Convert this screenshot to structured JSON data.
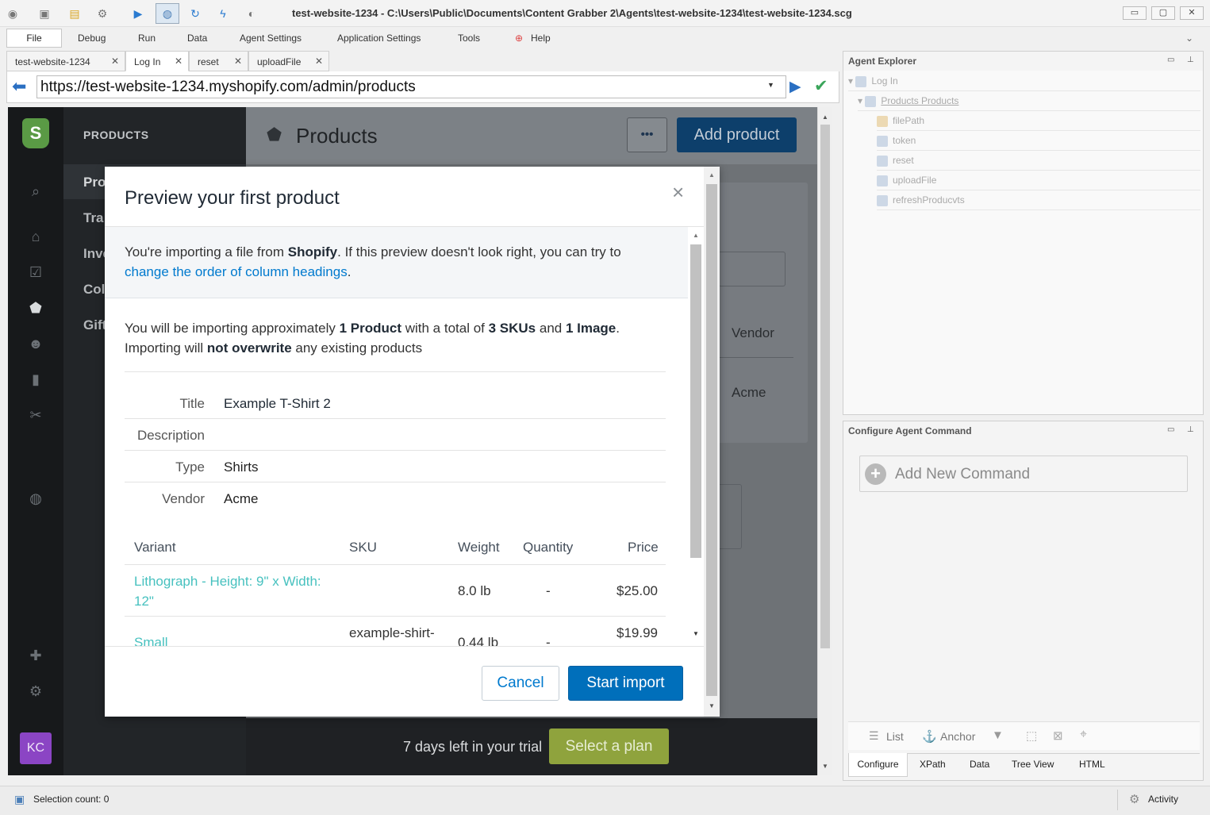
{
  "window": {
    "title": "test-website-1234 - C:\\Users\\Public\\Documents\\Content Grabber 2\\Agents\\test-website-1234\\test-website-1234.scg",
    "controls": [
      "▭",
      "▢",
      "✕"
    ]
  },
  "menu": {
    "items": [
      "File",
      "Debug",
      "Run",
      "Data",
      "Agent Settings",
      "Application Settings",
      "Tools",
      "Help"
    ]
  },
  "tabs": [
    {
      "label": "test-website-1234"
    },
    {
      "label": "Log In"
    },
    {
      "label": "reset"
    },
    {
      "label": "uploadFile"
    }
  ],
  "urlbar": {
    "url": "https://test-website-1234.myshopify.com/admin/products"
  },
  "shopify": {
    "section_title": "PRODUCTS",
    "nav": [
      "Pro",
      "Tra",
      "Inve",
      "Col",
      "Gift"
    ],
    "page_title": "Products",
    "more_label": "•••",
    "add_product_label": "Add product",
    "bg_vendor_header": "Vendor",
    "bg_vendor_value": "Acme",
    "avatar": "KC",
    "trial_text": "7 days left in your trial",
    "select_plan_label": "Select a plan"
  },
  "modal": {
    "title": "Preview your first product",
    "close": "×",
    "info_pre": "You're importing a file from ",
    "info_source": "Shopify",
    "info_post": ". If this preview doesn't look right, you can try to",
    "info_link": "change the order of column headings",
    "info_period": ".",
    "summary1_pre": "You will be importing approximately ",
    "summary1_products": "1 Product",
    "summary1_mid": " with a total of ",
    "summary1_skus": "3 SKUs",
    "summary1_and": " and ",
    "summary1_images": "1 Image",
    "summary1_end": ".",
    "summary2_pre": "Importing will ",
    "summary2_bold": "not overwrite",
    "summary2_post": " any existing products",
    "details": [
      {
        "label": "Title",
        "value": "Example T-Shirt 2"
      },
      {
        "label": "Description",
        "value": ""
      },
      {
        "label": "Type",
        "value": "Shirts"
      },
      {
        "label": "Vendor",
        "value": "Acme"
      }
    ],
    "table_headers": [
      "Variant",
      "SKU",
      "Weight",
      "Quantity",
      "Price"
    ],
    "rows": [
      {
        "variant_line1": "Lithograph - Height: 9\" x Width:",
        "variant_line2": "12\"",
        "sku": "",
        "weight": "8.0 lb",
        "quantity": "-",
        "price": "$25.00"
      },
      {
        "variant_line1": "Small",
        "variant_line2": "",
        "sku": "example-shirt-",
        "weight": "0.44 lb",
        "quantity": "-",
        "price": "$19.99"
      }
    ],
    "cancel_label": "Cancel",
    "start_label": "Start import"
  },
  "agent_explorer": {
    "title": "Agent Explorer",
    "items": [
      "Log In",
      "Products Products",
      "filePath",
      "token",
      "reset",
      "uploadFile",
      "refreshProducvts"
    ]
  },
  "configure": {
    "title": "Configure Agent Command",
    "add_label": "Add New Command",
    "toolbar": {
      "list": "List",
      "anchor": "Anchor"
    },
    "tabs": [
      "Configure",
      "XPath",
      "Data",
      "Tree View",
      "HTML"
    ]
  },
  "status": {
    "selection": "Selection count: 0",
    "activity": "Activity"
  },
  "colors": {
    "shopify_blue": "#006fbb",
    "link_teal": "#47c1bf",
    "plan_green": "#8fa33d"
  }
}
